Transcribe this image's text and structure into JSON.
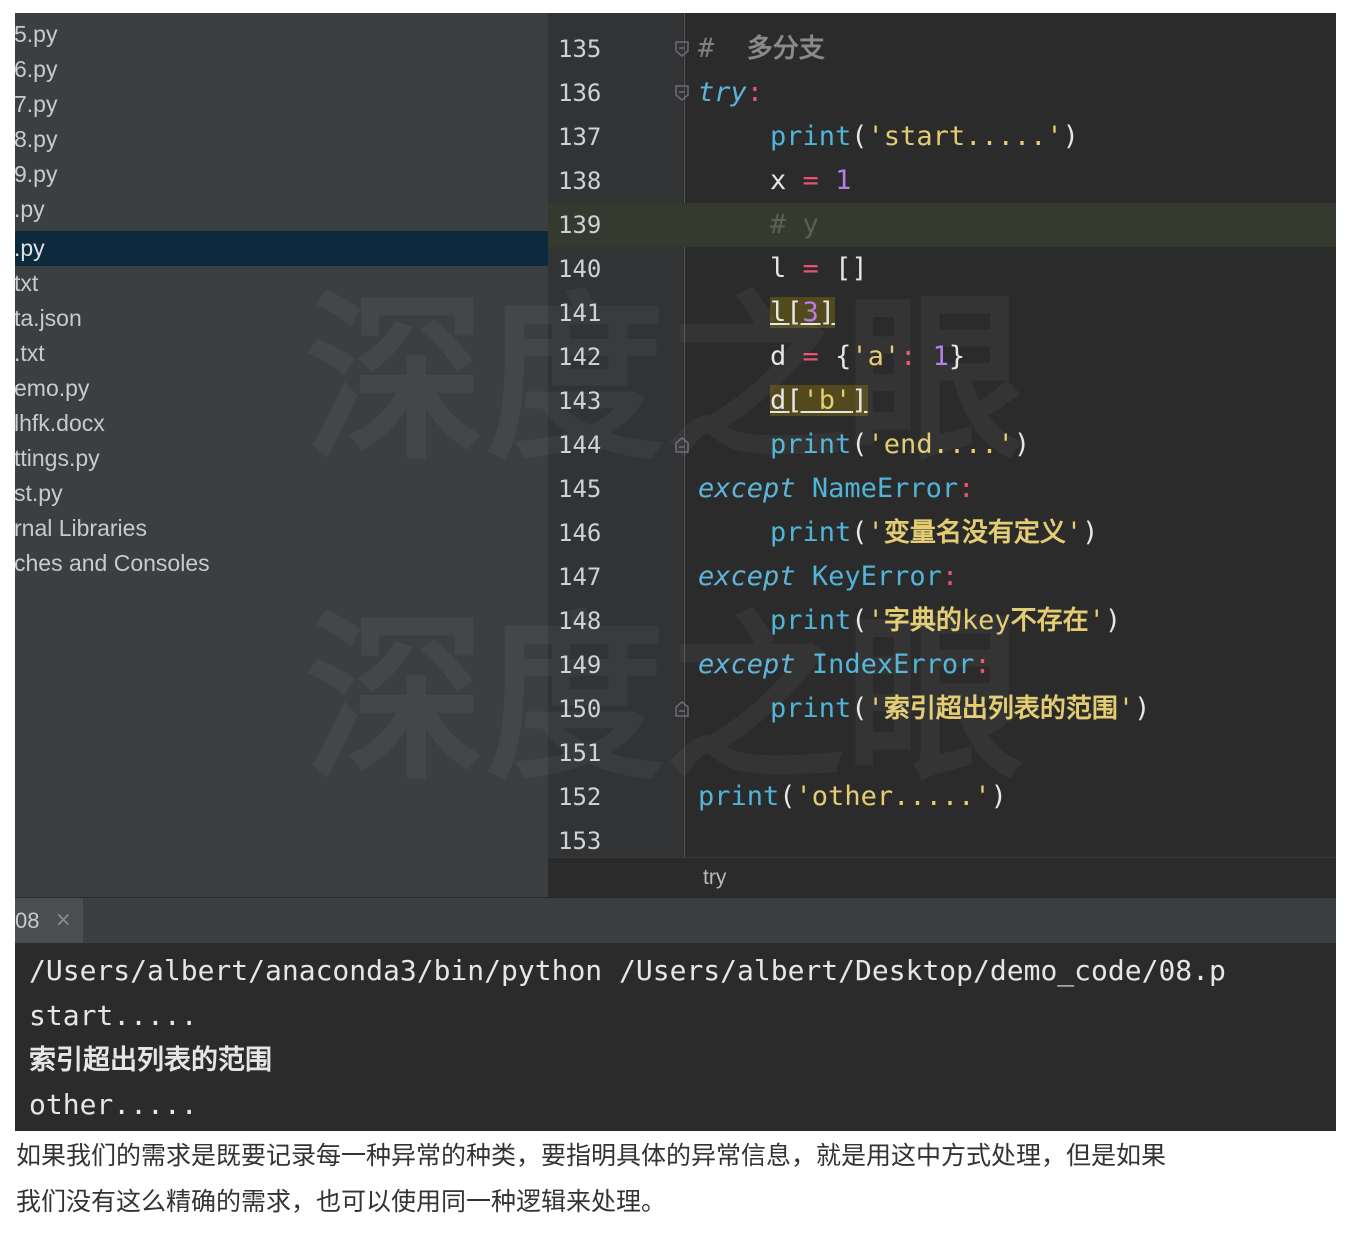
{
  "project_tree": {
    "items": [
      {
        "label": "5.py"
      },
      {
        "label": "6.py"
      },
      {
        "label": "7.py"
      },
      {
        "label": "8.py"
      },
      {
        "label": "9.py"
      },
      {
        "label": ".py"
      },
      {
        "label": ".py",
        "selected": true
      },
      {
        "label": "txt"
      },
      {
        "label": "ta.json"
      },
      {
        "label": ".txt"
      },
      {
        "label": "emo.py"
      },
      {
        "label": "lhfk.docx"
      },
      {
        "label": "ttings.py"
      },
      {
        "label": "st.py"
      },
      {
        "label": "rnal Libraries"
      },
      {
        "label": "ches and Consoles"
      }
    ]
  },
  "editor": {
    "line_numbers": [
      "135",
      "136",
      "137",
      "138",
      "139",
      "140",
      "141",
      "142",
      "143",
      "144",
      "145",
      "146",
      "147",
      "148",
      "149",
      "150",
      "151",
      "152",
      "153"
    ],
    "current_line": "139",
    "lines": {
      "l135": {
        "hash": "#",
        "comment": "多分支"
      },
      "l136": {
        "kw": "try",
        "colon": ":"
      },
      "l137": {
        "fn": "print",
        "open": "(",
        "str": "'start.....'",
        "close": ")"
      },
      "l138": {
        "var": "x",
        "op": "=",
        "num": "1"
      },
      "l139": {
        "comment": "# y"
      },
      "l140": {
        "var": "l",
        "op": "=",
        "rest": "[]"
      },
      "l141": {
        "var": "l",
        "open": "[",
        "num": "3",
        "close": "]"
      },
      "l142": {
        "var": "d",
        "op": "=",
        "open": "{",
        "key": "'a'",
        "colon": ":",
        "num": "1",
        "close": "}"
      },
      "l143": {
        "var": "d",
        "open": "[",
        "key": "'b'",
        "close": "]"
      },
      "l144": {
        "fn": "print",
        "open": "(",
        "str": "'end....'",
        "close": ")"
      },
      "l145": {
        "kw": "except",
        "exc": "NameError",
        "colon": ":"
      },
      "l146": {
        "fn": "print",
        "open": "(",
        "q1": "'",
        "cn": "变量名没有定义",
        "q2": "'",
        "close": ")"
      },
      "l147": {
        "kw": "except",
        "exc": "KeyError",
        "colon": ":"
      },
      "l148": {
        "fn": "print",
        "open": "(",
        "q1": "'",
        "cn1": "字典的",
        "mono": "key",
        "cn2": "不存在",
        "q2": "'",
        "close": ")"
      },
      "l149": {
        "kw": "except",
        "exc": "IndexError",
        "colon": ":"
      },
      "l150": {
        "fn": "print",
        "open": "(",
        "q1": "'",
        "cn": "索引超出列表的范围",
        "q2": "'",
        "close": ")"
      },
      "l152": {
        "fn": "print",
        "open": "(",
        "str": "'other.....'",
        "close": ")"
      }
    },
    "breadcrumb": "try"
  },
  "run_panel": {
    "tab_label": "08",
    "tab_close": "×",
    "console_lines": [
      "/Users/albert/anaconda3/bin/python /Users/albert/Desktop/demo_code/08.p",
      "start.....",
      "索引超出列表的范围",
      "other....."
    ]
  },
  "watermark": "深度之眼",
  "caption": {
    "line1": "如果我们的需求是既要记录每一种异常的种类，要指明具体的异常信息，就是用这中方式处理，但是如果",
    "line2": "我们没有这么精确的需求，也可以使用同一种逻辑来处理。"
  },
  "colors": {
    "editor_bg": "#2b2b2b",
    "tree_bg": "#3c3f41",
    "selection": "#0d293e",
    "keyword": "#5fb3d8",
    "string": "#e3cc72",
    "number": "#b97ce8",
    "operator": "#e8546e"
  }
}
